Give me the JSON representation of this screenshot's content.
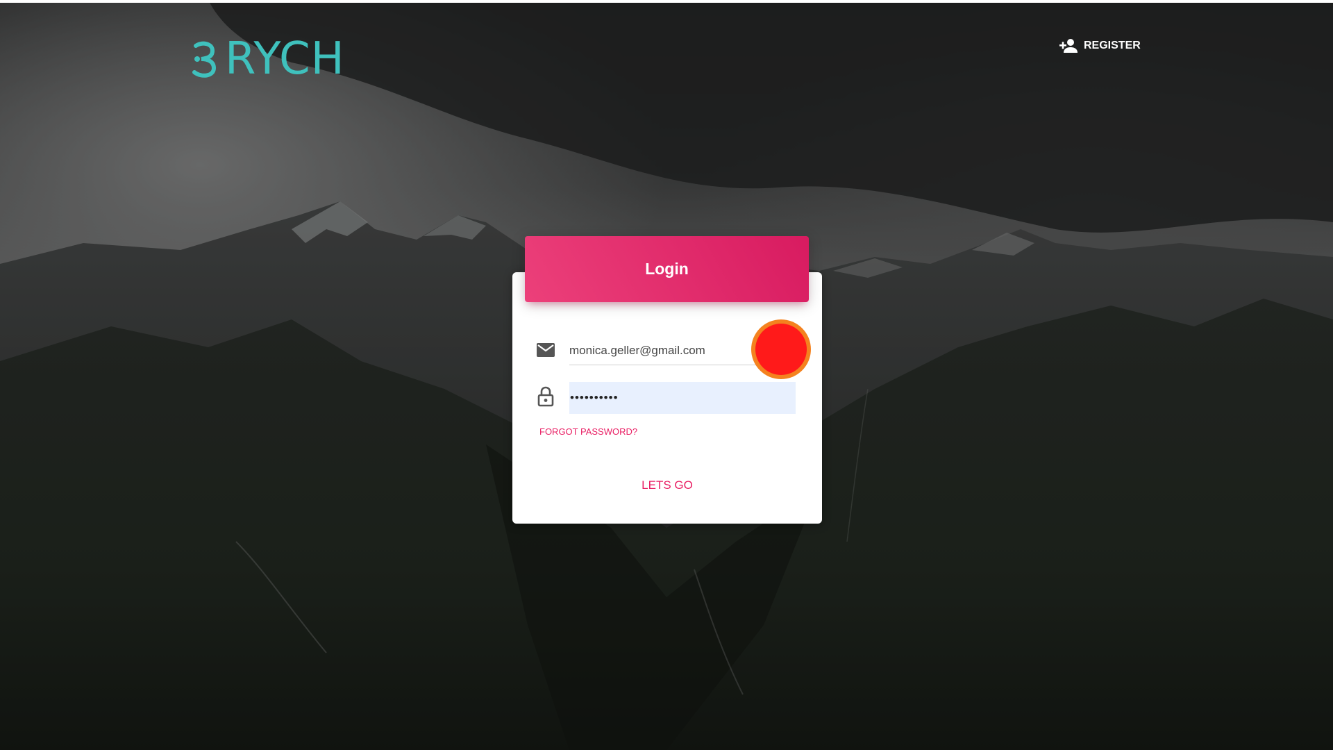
{
  "app": {
    "logo_text": "RYCH",
    "brand_color": "#3fc1bd"
  },
  "header": {
    "register_label": "REGISTER",
    "register_icon": "person-add-icon"
  },
  "login_card": {
    "title": "Login",
    "accent_color": "#e91e63",
    "email": {
      "icon": "envelope-icon",
      "value": "monica.geller@gmail.com"
    },
    "password": {
      "icon": "lock-icon",
      "value": "••••••••••",
      "autofill_bg": "#e8f0fe"
    },
    "forgot_label": "FORGOT PASSWORD?",
    "submit_label": "LETS GO"
  },
  "overlay": {
    "click_marker_color": "#ff1a1a"
  }
}
